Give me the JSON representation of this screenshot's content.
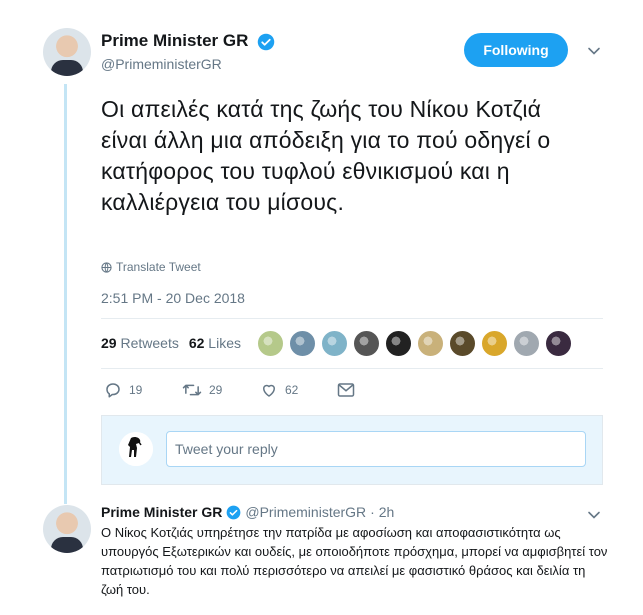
{
  "main_tweet": {
    "author_name": "Prime Minister GR",
    "handle": "@PrimeministerGR",
    "follow_label": "Following",
    "text": "Οι απειλές κατά της ζωής του Νίκου Κοτζιά είναι άλλη μια απόδειξη για το πού οδηγεί ο κατήφορος του τυφλού εθνικισμού και η καλλιέργεια του μίσους.",
    "translate_label": "Translate Tweet",
    "timestamp": "2:51 PM - 20 Dec 2018",
    "retweets_count": "29",
    "retweets_label": "Retweets",
    "likes_count": "62",
    "likes_label": "Likes",
    "likers": [
      "#b5c98a",
      "#6e8fa8",
      "#7fb3c8",
      "#555555",
      "#222222",
      "#c9b17a",
      "#5a4a2a",
      "#d9a72b",
      "#a0a8b0",
      "#3a2a40"
    ],
    "actions": {
      "reply_count": "19",
      "retweet_count": "29",
      "like_count": "62"
    }
  },
  "reply_composer": {
    "placeholder": "Tweet your reply"
  },
  "reply_tweet": {
    "author_name": "Prime Minister GR",
    "handle": "@PrimeministerGR",
    "time": "· 2h",
    "text": "Ο Νίκος Κοτζιάς υπηρέτησε την πατρίδα με αφοσίωση και αποφασιστικότητα ως υπουργός Εξωτερικών και ουδείς, με οποιοδήποτε πρόσχημα, μπορεί να αμφισβητεί τον πατριωτισμό του και πολύ περισσότερο να απειλεί με φασιστικό θράσος και δειλία τη ζωή του."
  },
  "colors": {
    "accent": "#1da1f2",
    "muted": "#657786",
    "thread_line": "#c4e5f5"
  }
}
